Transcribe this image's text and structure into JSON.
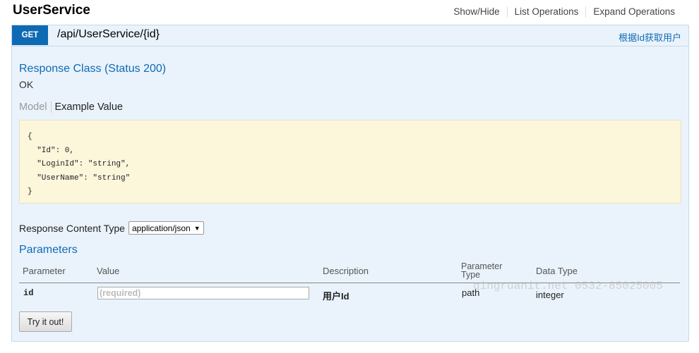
{
  "resource": {
    "title": "UserService"
  },
  "topnav": {
    "show_hide": "Show/Hide",
    "list_operations": "List Operations",
    "expand_operations": "Expand Operations"
  },
  "operation": {
    "method": "GET",
    "path": "/api/UserService/{id}",
    "summary": "根据Id获取用户"
  },
  "response": {
    "class_title": "Response Class (Status 200)",
    "status_text": "OK",
    "tab_model": "Model",
    "tab_example": "Example Value",
    "example_value": "{\n  \"Id\": 0,\n  \"LoginId\": \"string\",\n  \"UserName\": \"string\"\n}"
  },
  "content_type": {
    "label": "Response Content Type",
    "selected": "application/json"
  },
  "parameters": {
    "title": "Parameters",
    "headers": {
      "parameter": "Parameter",
      "value": "Value",
      "description": "Description",
      "parameter_type_1": "Parameter",
      "parameter_type_2": "Type",
      "data_type": "Data Type"
    },
    "rows": [
      {
        "name": "id",
        "placeholder": "(required)",
        "description": "用户Id",
        "param_type": "path",
        "data_type": "integer"
      }
    ]
  },
  "try_button": "Try it out!",
  "watermark": "qingruanit.net 0532-85025005",
  "colors": {
    "accent": "#0f6ab4",
    "panel_bg": "#eaf3fb",
    "sample_bg": "#fcf6db"
  }
}
